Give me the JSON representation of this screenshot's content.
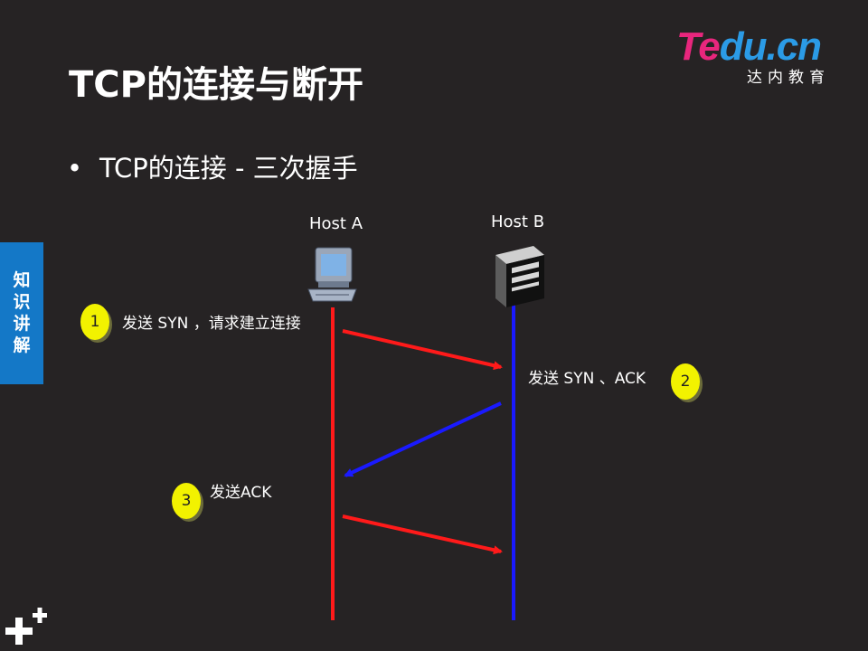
{
  "logo": {
    "brand_part1": "Te",
    "brand_part2": "du.cn",
    "subtitle": "达内教育",
    "pink": "#e8267d",
    "blue": "#2b9be6"
  },
  "slide": {
    "title": "TCP的连接与断开",
    "bullet": "TCP的连接 - 三次握手",
    "side_tab": "知识讲解"
  },
  "diagram": {
    "host_a": {
      "label": "Host A",
      "icon": "computer-icon",
      "line_color": "#ff1a1a"
    },
    "host_b": {
      "label": "Host B",
      "icon": "server-icon",
      "line_color": "#1a1aff"
    },
    "steps": [
      {
        "number": "1",
        "text": "发送 SYN ，请求建立连接",
        "direction": "A-to-B"
      },
      {
        "number": "2",
        "text": "发送 SYN 、ACK",
        "direction": "B-to-A"
      },
      {
        "number": "3",
        "text": "发送ACK",
        "direction": "A-to-B"
      }
    ],
    "step_color": "#f2f200"
  },
  "footer": {
    "icon": "plus-icon"
  }
}
